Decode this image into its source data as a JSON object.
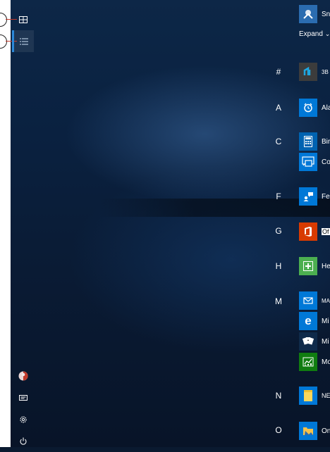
{
  "expand_label": "Expand",
  "expand_chevron": "⌄",
  "top_apps": [
    {
      "name": "Sn",
      "icon": "snip-icon",
      "color": "#2b6cb0"
    }
  ],
  "groups": [
    {
      "letter": "#",
      "apps": [
        {
          "name": "3B",
          "icon": "3d-builder-icon",
          "color": "#3c3c3c"
        }
      ]
    },
    {
      "letter": "A",
      "apps": [
        {
          "name": "Ala",
          "icon": "alarm-clock-icon",
          "color": "#0078d7"
        }
      ]
    },
    {
      "letter": "C",
      "apps": [
        {
          "name": "Bir",
          "icon": "calculator-icon",
          "color": "#0063b1"
        },
        {
          "name": "Co",
          "icon": "connect-icon",
          "color": "#0078d7"
        }
      ]
    },
    {
      "letter": "F",
      "apps": [
        {
          "name": "Fe",
          "icon": "feedback-icon",
          "color": "#0078d7"
        }
      ]
    },
    {
      "letter": "G",
      "apps": [
        {
          "name": "Of",
          "icon": "office-icon",
          "color": "#d83b01"
        }
      ]
    },
    {
      "letter": "H",
      "apps": [
        {
          "name": "He",
          "icon": "health-icon",
          "color": "#4caf50"
        }
      ]
    },
    {
      "letter": "M",
      "apps": [
        {
          "name": "MA",
          "icon": "mail-icon",
          "color": "#0078d7"
        },
        {
          "name": "Mi",
          "icon": "edge-icon",
          "color": "#0078d7"
        },
        {
          "name": "Mi",
          "icon": "solitaire-icon",
          "color": "#0f2a4a"
        },
        {
          "name": "Mo",
          "icon": "money-icon",
          "color": "#107c10"
        }
      ]
    },
    {
      "letter": "N",
      "apps": [
        {
          "name": "NE",
          "icon": "notes-icon",
          "color": "#0078d7"
        }
      ]
    },
    {
      "letter": "O",
      "apps": [
        {
          "name": "On",
          "icon": "onedrive-folder-icon",
          "color": "#0078d7"
        }
      ]
    }
  ]
}
